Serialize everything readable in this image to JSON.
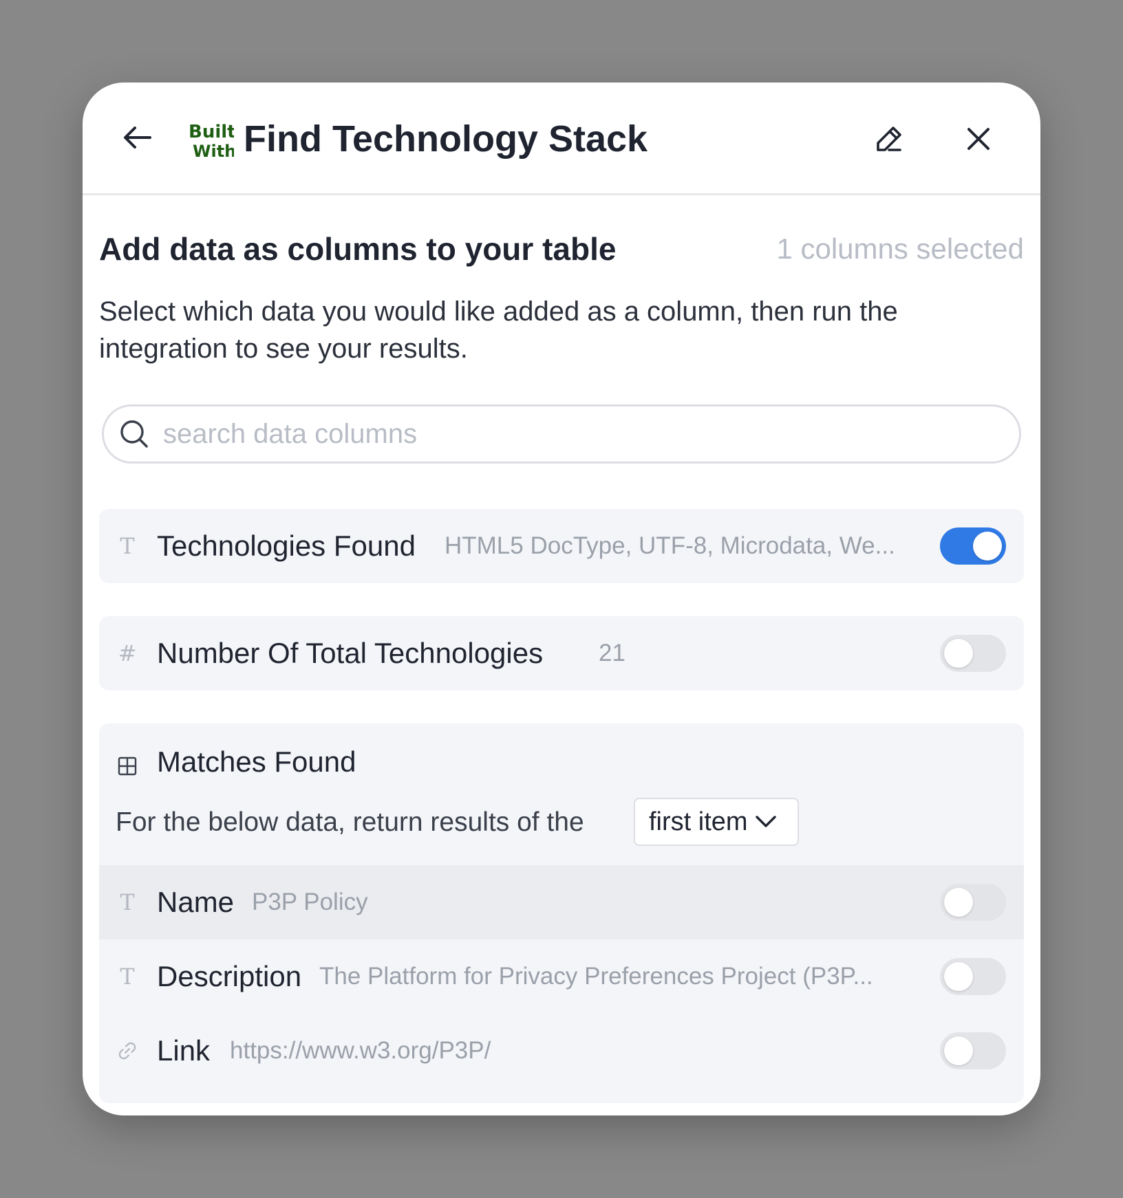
{
  "header": {
    "title": "Find Technology Stack",
    "logo_text_top": "Built",
    "logo_text_bottom": "With",
    "logo_color": "#1f5f14"
  },
  "section": {
    "heading": "Add data as columns to your table",
    "selected_count": "1 columns selected",
    "instructions": "Select which data you would like added as a column, then run the integration to see your results."
  },
  "search": {
    "placeholder": "search data columns",
    "value": ""
  },
  "columns": [
    {
      "type_icon": "text-type-icon",
      "label": "Technologies Found",
      "value": "HTML5 DocType, UTF-8, Microdata, We...",
      "enabled": true
    },
    {
      "type_icon": "number-type-icon",
      "label": "Number Of Total Technologies",
      "value": "21",
      "enabled": false
    }
  ],
  "matches": {
    "label": "Matches Found",
    "type_icon": "table-type-icon",
    "return_text": "For the below data, return results of the",
    "dropdown_selected": "first item",
    "fields": [
      {
        "type_icon": "text-type-icon",
        "label": "Name",
        "value": "P3P Policy",
        "enabled": false
      },
      {
        "type_icon": "text-type-icon",
        "label": "Description",
        "value": "The Platform for Privacy Preferences Project (P3P...",
        "enabled": false
      },
      {
        "type_icon": "link-type-icon",
        "label": "Link",
        "value": "https://www.w3.org/P3P/",
        "enabled": false
      }
    ]
  },
  "colors": {
    "toggle_on": "#2f7ae5",
    "toggle_off": "#e3e4e8",
    "muted_text": "#9aa0aa"
  }
}
